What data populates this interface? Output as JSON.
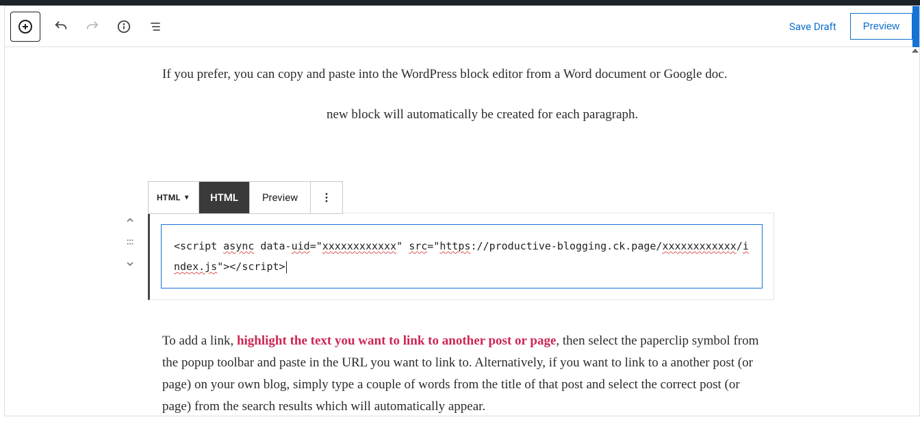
{
  "toolbar": {
    "save_draft": "Save Draft",
    "preview": "Preview"
  },
  "content": {
    "p1": "If you prefer,  you can copy and paste into the WordPress block editor from a Word document or Google doc.",
    "p2_fragment": "new block will automatically be created for each paragraph.",
    "link_para_before": "To add a link, ",
    "link_para_highlight": "highlight the text you want to link to another post or page",
    "link_para_after": ", then select the paperclip symbol from the popup toolbar and paste in the URL you want to link to. Alternatively, if you want to link to a another post (or page) on your own blog, simply type a couple of words from the title of that post and select the correct post (or page) from the search results which will automatically appear."
  },
  "block_toolbar": {
    "type_label": "HTML",
    "tab_html": "HTML",
    "tab_preview": "Preview"
  },
  "code": {
    "t1": "<script ",
    "t2_async": "async",
    "t3": " data-",
    "t4_uid": "uid",
    "t5": "=\"",
    "t6_x": "xxxxxxxxxxxx",
    "t7": "\" ",
    "t8_src": "src",
    "t9": "=\"",
    "t10_https": "https",
    "t11": "://productive-blogging.ck.page/",
    "t12_x2": "xxxxxxxxxxxx",
    "t13": "/",
    "t14_index": "index.js",
    "t15": "\"></script>"
  }
}
